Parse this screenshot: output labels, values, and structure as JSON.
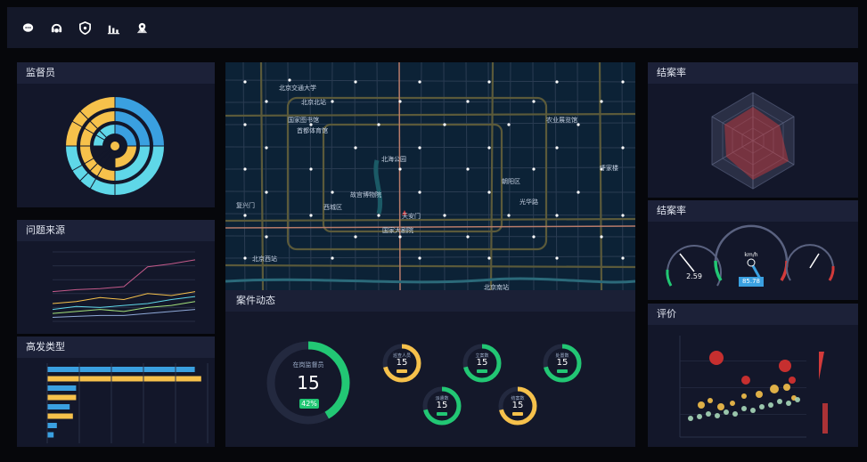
{
  "colors": {
    "accent_yellow": "#f6c14b",
    "accent_blue": "#3aa0e0",
    "accent_cyan": "#5fd7e8",
    "accent_green": "#22c774",
    "accent_red": "#d23a3a",
    "bg": "#06070b",
    "panel": "#13172a"
  },
  "toolbar": {
    "icons": [
      "chat-icon",
      "headset-icon",
      "shield-icon",
      "bar-chart-icon",
      "map-pin-icon"
    ]
  },
  "panels": {
    "supervisor_title": "监督员",
    "source_title": "问题来源",
    "type_title": "高发类型",
    "closure_title": "结案率",
    "closure2_title": "结案率",
    "eval_title": "评价",
    "case_title": "案件动态"
  },
  "map": {
    "labels": [
      "北京交通大学",
      "北京北站",
      "国家图书馆",
      "首都体育馆",
      "北海公园",
      "故宫博物院",
      "复兴门",
      "西城区",
      "天安门",
      "国家大剧院",
      "朝阳区",
      "光华路",
      "农业展览馆",
      "呼家楼",
      "北京西站",
      "北京南站"
    ]
  },
  "case": {
    "main_label": "在岗监督员",
    "main_value": "15",
    "main_pct": "42%",
    "gauges": [
      {
        "label": "巡查人员",
        "value": "15",
        "color": "yellow"
      },
      {
        "label": "立案数",
        "value": "15",
        "color": "green"
      },
      {
        "label": "派遣数",
        "value": "15",
        "color": "green"
      },
      {
        "label": "处置数",
        "value": "15",
        "color": "green"
      },
      {
        "label": "结案数",
        "value": "15",
        "color": "yellow"
      }
    ]
  },
  "speed": {
    "left": "2.59",
    "center": "85.78",
    "unit": "km/h"
  },
  "chart_data": [
    {
      "type": "line",
      "title": "问题来源",
      "series": [
        {
          "values": [
            30,
            32,
            33,
            35,
            55,
            58,
            62
          ]
        },
        {
          "values": [
            18,
            20,
            24,
            22,
            28,
            26,
            30
          ]
        },
        {
          "values": [
            12,
            15,
            14,
            16,
            18,
            22,
            25
          ]
        },
        {
          "values": [
            8,
            10,
            12,
            10,
            14,
            16,
            20
          ]
        },
        {
          "values": [
            4,
            5,
            6,
            6,
            8,
            10,
            12
          ]
        }
      ]
    },
    {
      "type": "bar",
      "title": "高发类型",
      "values": [
        92,
        96,
        18,
        18,
        14,
        16,
        6,
        4
      ],
      "series_colors": [
        "#3aa0e0",
        "#f6c14b",
        "#3aa0e0",
        "#f6c14b",
        "#3aa0e0",
        "#f6c14b",
        "#3aa0e0",
        "#3aa0e0"
      ]
    }
  ]
}
